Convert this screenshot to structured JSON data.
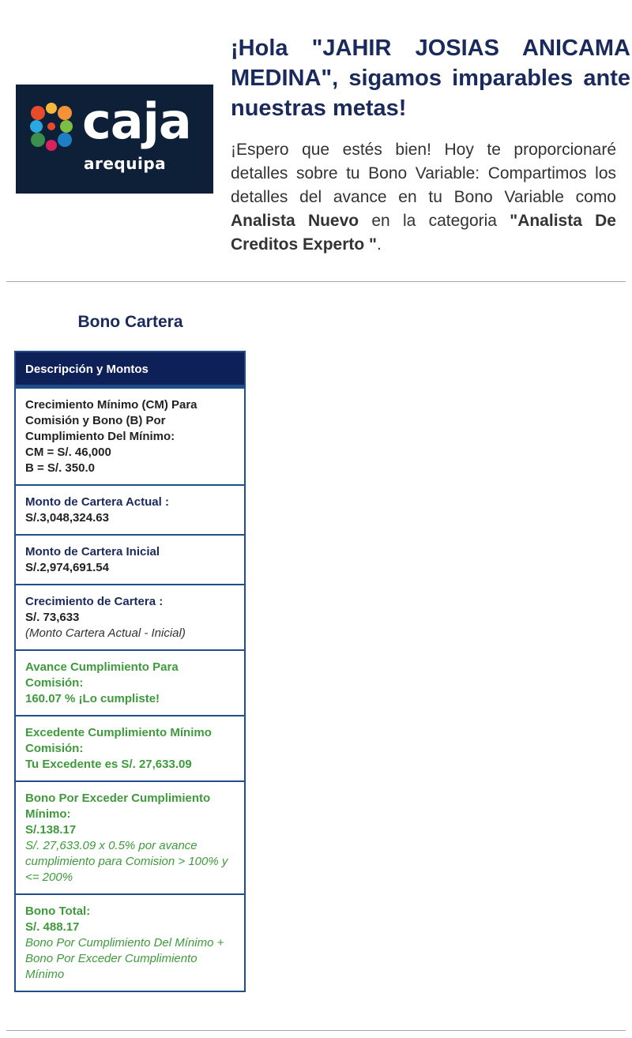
{
  "header": {
    "logo": {
      "word": "caja",
      "sub": "arequipa"
    },
    "greeting_title": "¡Hola \"JAHIR JOSIAS ANICAMA MEDINA\", sigamos imparables ante nuestras metas!",
    "intro_text": "¡Espero que estés bien! Hoy te proporcionaré detalles sobre tu Bono Variable: Compartimos los detalles del avance en tu Bono Variable como ",
    "role": "Analista Nuevo",
    "category_prefix": " en la categoria ",
    "category": "\"Analista De Creditos Experto \"",
    "period": "."
  },
  "section": {
    "title": "Bono Cartera",
    "table_header": "Descripción y Montos"
  },
  "rows": {
    "cm": {
      "label": "Crecimiento Mínimo (CM) Para Comisión y Bono (B) Por Cumplimiento Del Mínimo:",
      "cm_value": "CM = S/. 46,000",
      "b_value": "B = S/. 350.0"
    },
    "actual": {
      "label": "Monto de Cartera Actual :",
      "value": "S/.3,048,324.63"
    },
    "inicial": {
      "label": "Monto de Cartera Inicial",
      "value": "S/.2,974,691.54"
    },
    "crecimiento": {
      "label": "Crecimiento de Cartera :",
      "value": "S/. 73,633",
      "note": "(Monto Cartera Actual - Inicial)"
    },
    "avance": {
      "label": "Avance Cumplimiento Para Comisión:",
      "value": "160.07 % ¡Lo cumpliste!"
    },
    "excedente": {
      "label": "Excedente Cumplimiento Mínimo Comisión:",
      "value": "Tu Excedente es S/. 27,633.09"
    },
    "bono_exceder": {
      "label": "Bono Por Exceder Cumplimiento Mínimo:",
      "value": "S/.138.17",
      "note": "S/. 27,633.09 x 0.5% por avance cumplimiento para Comision > 100% y <= 200%"
    },
    "bono_total": {
      "label": "Bono Total:",
      "value": "S/. 488.17",
      "note": "Bono Por Cumplimiento Del Mínimo + Bono Por Exceder Cumplimiento Mínimo"
    }
  },
  "colors": {
    "navy": "#1a2a5c",
    "header_bg": "#0e2058",
    "border": "#1f4e8a",
    "green": "#3f9a3c",
    "logo_bg": "#0e2038"
  }
}
